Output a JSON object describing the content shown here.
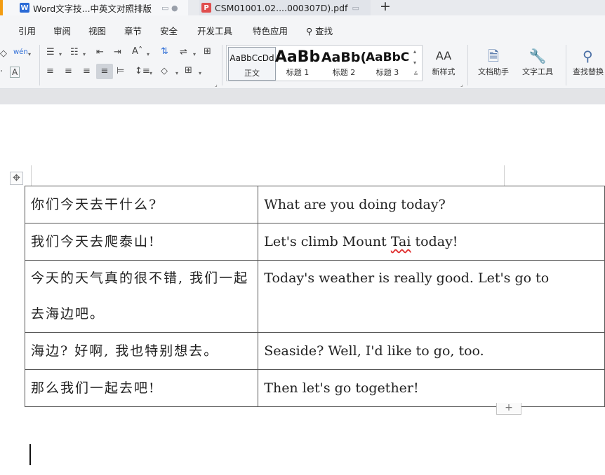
{
  "tabs": [
    {
      "icon": "W",
      "icon_color": "#2b6bd6",
      "title": "Word文字技...中英文对照排版"
    },
    {
      "icon": "P",
      "icon_color": "#e04e4e",
      "title": "CSM01001.02....000307D).pdf"
    }
  ],
  "new_tab": "+",
  "menu": [
    "引用",
    "审阅",
    "视图",
    "章节",
    "安全",
    "开发工具",
    "特色应用",
    "查找"
  ],
  "ribbon": {
    "font_color_glyph": "A",
    "pinyin_glyph": "wén",
    "styles": [
      {
        "preview": "AaBbCcDd",
        "label": "正文"
      },
      {
        "preview": "AaBb",
        "label": "标题 1"
      },
      {
        "preview": "AaBb(",
        "label": "标题 2"
      },
      {
        "preview": "AaBbC",
        "label": "标题 3"
      }
    ],
    "new_style": "新样式",
    "new_style_glyph": "AA",
    "tools": [
      "文档助手",
      "文字工具",
      "查找替换"
    ]
  },
  "document": {
    "table": [
      [
        "你们今天去干什么?",
        "What are you doing today?"
      ],
      [
        "我们今天去爬泰山!",
        "Let's climb Mount ",
        "Tai",
        " today!"
      ],
      [
        "今天的天气真的很不错, 我们一起去海边吧。",
        "Today's weather is really good. Let's go to"
      ],
      [
        "海边? 好啊, 我也特别想去。",
        "Seaside? Well, I'd like to go, too."
      ],
      [
        "那么我们一起去吧!",
        "Then let's go together!"
      ]
    ],
    "add_row": "+"
  },
  "colors": {
    "accent": "#2b6bd6",
    "pdf": "#e04e4e",
    "spell": "#e03030"
  }
}
